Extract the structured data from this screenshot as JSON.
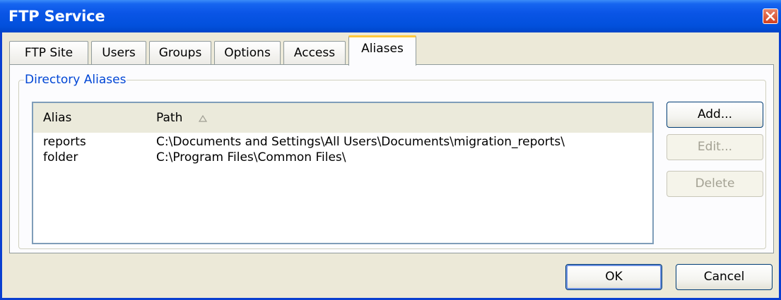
{
  "window": {
    "title": "FTP Service"
  },
  "tabs": [
    {
      "label": "FTP Site",
      "active": false
    },
    {
      "label": "Users",
      "active": false
    },
    {
      "label": "Groups",
      "active": false
    },
    {
      "label": "Options",
      "active": false
    },
    {
      "label": "Access",
      "active": false
    },
    {
      "label": "Aliases",
      "active": true
    }
  ],
  "group": {
    "title": "Directory Aliases"
  },
  "list": {
    "columns": {
      "alias": "Alias",
      "path": "Path"
    },
    "sort": {
      "column": "Path",
      "icon": "sort-triangle-icon"
    },
    "rows": [
      {
        "alias": "reports",
        "path": "C:\\Documents and Settings\\All Users\\Documents\\migration_reports\\"
      },
      {
        "alias": "folder",
        "path": "C:\\Program Files\\Common Files\\"
      }
    ]
  },
  "side_buttons": {
    "add": "Add...",
    "edit": "Edit...",
    "delete": "Delete"
  },
  "footer": {
    "ok": "OK",
    "cancel": "Cancel"
  },
  "colors": {
    "titlebar": "#0a55e6",
    "group_title": "#0046d5",
    "active_tab_accent": "#ffc83c"
  }
}
